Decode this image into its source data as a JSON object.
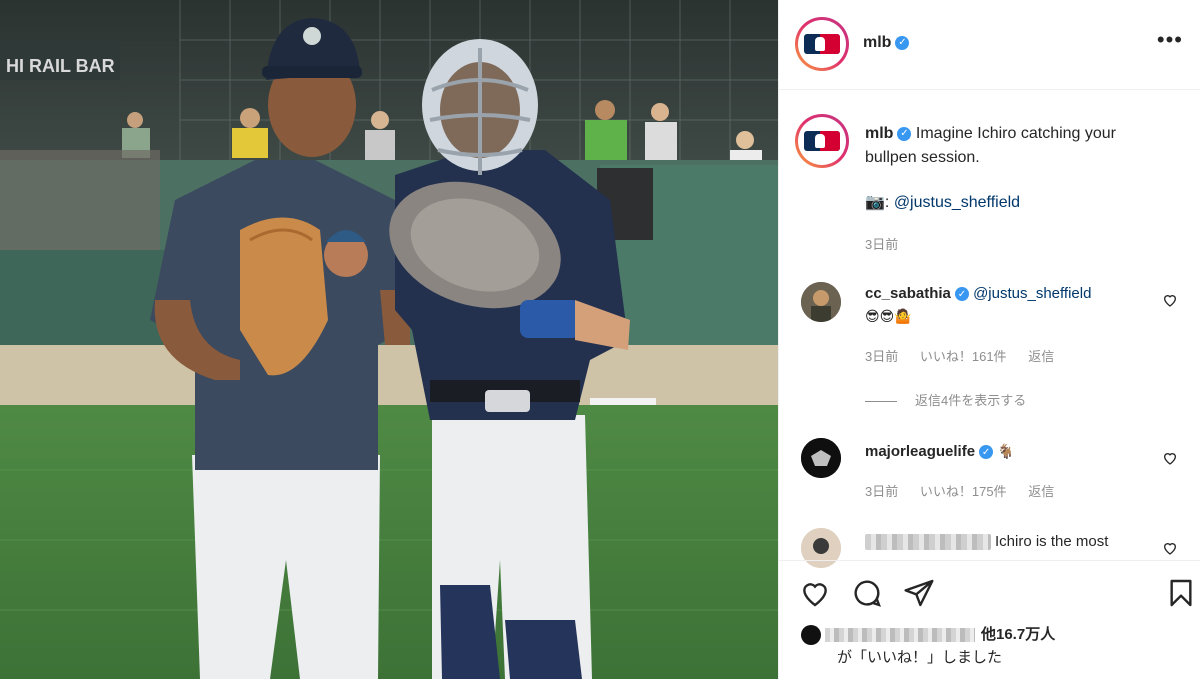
{
  "post": {
    "author": "mlb",
    "caption": "Imagine Ichiro catching your bullpen session.",
    "credit_prefix": "📷: ",
    "credit_link": "@justus_sheffield",
    "timestamp": "3日前"
  },
  "comments": [
    {
      "user": "cc_sabathia",
      "text": "@justus_sheffield",
      "emojis": "😎😎🤷",
      "time": "3日前",
      "likes": "いいね！161件",
      "reply": "返信"
    },
    {
      "user": "majorleaguelife",
      "text": "🐐",
      "time": "3日前",
      "likes": "いいね！175件",
      "reply": "返信"
    },
    {
      "user": "",
      "text": "Ichiro is the most"
    }
  ],
  "show_replies": "返信4件を表示する",
  "likes": {
    "count_text": "他16.7万人",
    "suffix": "が「いいね！」しました"
  },
  "icons": {
    "verified": "verified-icon",
    "more": "more-options-icon",
    "like": "heart-icon",
    "comment": "comment-icon",
    "share": "share-icon",
    "save": "bookmark-icon"
  },
  "colors": {
    "verified": "#3897f0",
    "link": "#00376b",
    "muted": "#8e8e8e"
  }
}
